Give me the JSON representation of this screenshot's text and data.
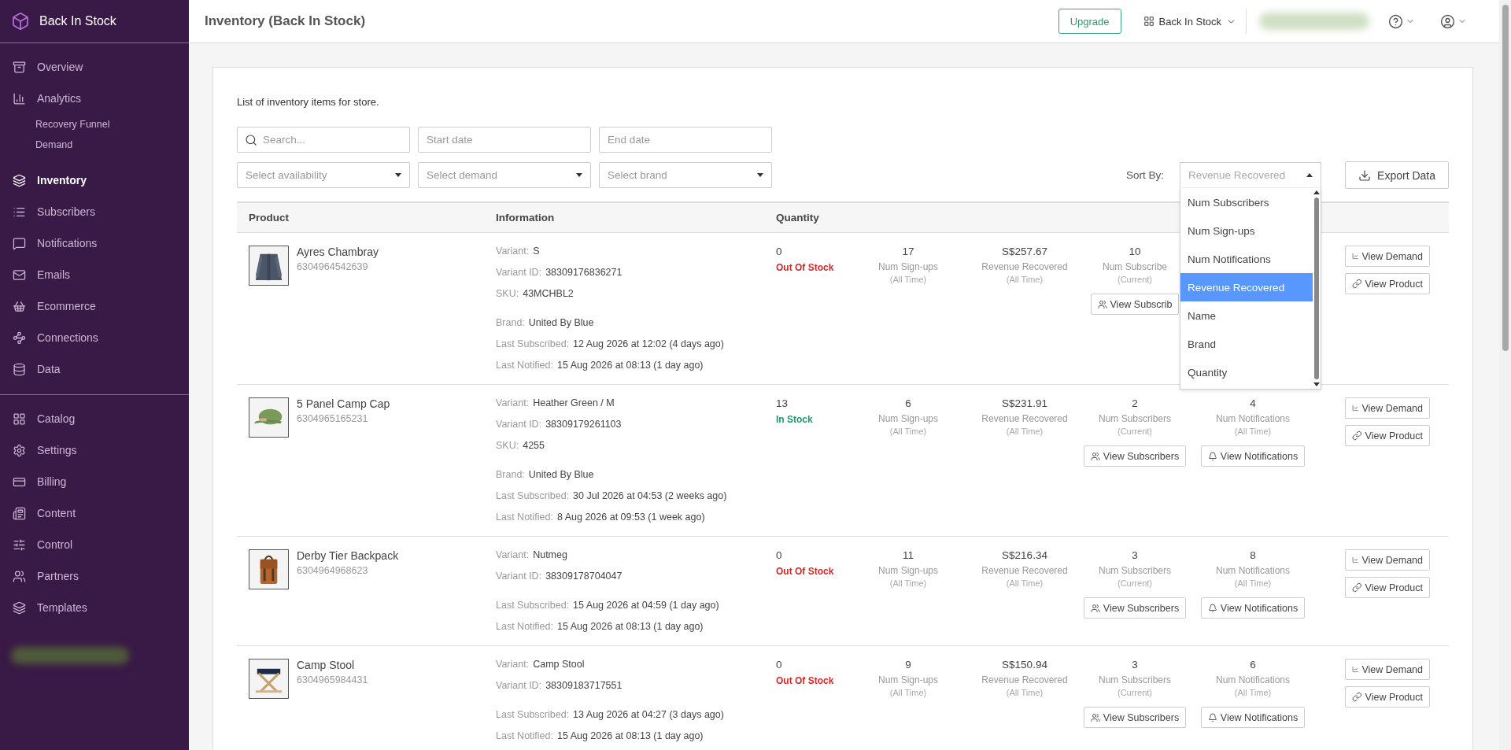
{
  "sidebar": {
    "brand": "Back In Stock",
    "sections": [
      {
        "items": [
          {
            "label": "Overview",
            "selected": false
          },
          {
            "label": "Analytics",
            "selected": false,
            "children": [
              {
                "label": "Recovery Funnel",
                "selected": false
              },
              {
                "label": "Demand",
                "selected": false
              }
            ]
          },
          {
            "label": "Inventory",
            "selected": true
          },
          {
            "label": "Subscribers",
            "selected": false
          },
          {
            "label": "Notifications",
            "selected": false
          },
          {
            "label": "Emails",
            "selected": false
          },
          {
            "label": "Ecommerce",
            "selected": false
          },
          {
            "label": "Connections",
            "selected": false
          },
          {
            "label": "Data",
            "selected": false
          }
        ]
      },
      {
        "items": [
          {
            "label": "Catalog",
            "selected": false
          },
          {
            "label": "Settings",
            "selected": false
          },
          {
            "label": "Billing",
            "selected": false
          },
          {
            "label": "Content",
            "selected": false
          },
          {
            "label": "Control",
            "selected": false
          },
          {
            "label": "Partners",
            "selected": false
          },
          {
            "label": "Templates",
            "selected": false
          }
        ]
      }
    ]
  },
  "header": {
    "title": "Inventory (Back In Stock)",
    "upgrade": "Upgrade",
    "store": "Back In Stock"
  },
  "content": {
    "description": "List of inventory items for store.",
    "search": {
      "placeholder": "Search..."
    },
    "start_date": {
      "placeholder": "Start date"
    },
    "end_date": {
      "placeholder": "End date"
    },
    "selects": [
      {
        "placeholder": "Select availability"
      },
      {
        "placeholder": "Select demand"
      },
      {
        "placeholder": "Select brand"
      }
    ],
    "sort": {
      "label": "Sort By:",
      "placeholder": "Revenue Recovered",
      "expanded": true,
      "options": [
        {
          "label": "Num Subscribers",
          "selected": false
        },
        {
          "label": "Num Sign-ups",
          "selected": false
        },
        {
          "label": "Num Notifications",
          "selected": false
        },
        {
          "label": "Revenue Recovered",
          "selected": true
        },
        {
          "label": "Name",
          "selected": false
        },
        {
          "label": "Brand",
          "selected": false
        },
        {
          "label": "Quantity",
          "selected": false
        }
      ]
    },
    "export": "Export Data"
  },
  "table": {
    "columns": [
      "Product",
      "Information",
      "Quantity"
    ],
    "rows": [
      {
        "name": "Ayres Chambray",
        "id": "6304964542639",
        "picture": {
          "kind": "picture"
        },
        "info": [
          [
            {
              "label": "Variant:",
              "value": "S"
            },
            {
              "label": "Variant ID:",
              "value": "38309176836271"
            },
            {
              "label": "SKU:",
              "value": "43MCHBL2"
            }
          ],
          [
            {
              "label": "Brand:",
              "value": "United By Blue"
            },
            {
              "label": "Last Subscribed:",
              "value": "12 Aug 2026 at 12:02 (4 days ago)"
            },
            {
              "label": "Last Notified:",
              "value": "15 Aug 2026 at 08:13 (1 day ago)"
            }
          ]
        ],
        "quantity": "0",
        "in_stock": false,
        "stock_label": "Out Of Stock",
        "stats": [
          {
            "value": "17",
            "label": "Num Sign-ups",
            "period": "(All Time)"
          },
          {
            "value": "S$257.67",
            "label": "Revenue Recovered",
            "period": "(All Time)"
          },
          {
            "value": "10",
            "label": "Num Subscribe",
            "period": "(Current)",
            "button": "View Subscrib"
          }
        ],
        "actions": [
          "View Demand",
          "View Product"
        ]
      },
      {
        "name": "5 Panel Camp Cap",
        "id": "6304965165231",
        "picture": {
          "kind": "picture"
        },
        "info": [
          [
            {
              "label": "Variant:",
              "value": "Heather Green / M"
            },
            {
              "label": "Variant ID:",
              "value": "38309179261103"
            },
            {
              "label": "SKU:",
              "value": "4255"
            }
          ],
          [
            {
              "label": "Brand:",
              "value": "United By Blue"
            },
            {
              "label": "Last Subscribed:",
              "value": "30 Jul 2026 at 04:53 (2 weeks ago)"
            },
            {
              "label": "Last Notified:",
              "value": "8 Aug 2026 at 09:53 (1 week ago)"
            }
          ]
        ],
        "quantity": "13",
        "in_stock": true,
        "stock_label": "In Stock",
        "stats": [
          {
            "value": "6",
            "label": "Num Sign-ups",
            "period": "(All Time)"
          },
          {
            "value": "S$231.91",
            "label": "Revenue Recovered",
            "period": "(All Time)"
          },
          {
            "value": "2",
            "label": "Num Subscribers",
            "period": "(Current)",
            "button": "View Subscribers"
          },
          {
            "value": "4",
            "label": "Num Notifications",
            "period": "(All Time)",
            "button": "View Notifications"
          }
        ],
        "actions": [
          "View Demand",
          "View Product"
        ]
      },
      {
        "name": "Derby Tier Backpack",
        "id": "6304964968623",
        "picture": {
          "kind": "picture"
        },
        "info": [
          [
            {
              "label": "Variant:",
              "value": "Nutmeg"
            },
            {
              "label": "Variant ID:",
              "value": "38309178704047"
            }
          ],
          [
            {
              "label": "Last Subscribed:",
              "value": "15 Aug 2026 at 04:59 (1 day ago)"
            },
            {
              "label": "Last Notified:",
              "value": "15 Aug 2026 at 08:13 (1 day ago)"
            }
          ]
        ],
        "quantity": "0",
        "in_stock": false,
        "stock_label": "Out Of Stock",
        "stats": [
          {
            "value": "11",
            "label": "Num Sign-ups",
            "period": "(All Time)"
          },
          {
            "value": "S$216.34",
            "label": "Revenue Recovered",
            "period": "(All Time)"
          },
          {
            "value": "3",
            "label": "Num Subscribers",
            "period": "(Current)",
            "button": "View Subscribers"
          },
          {
            "value": "8",
            "label": "Num Notifications",
            "period": "(All Time)",
            "button": "View Notifications"
          }
        ],
        "actions": [
          "View Demand",
          "View Product"
        ]
      },
      {
        "name": "Camp Stool",
        "id": "6304965984431",
        "picture": {
          "kind": "picture"
        },
        "info": [
          [
            {
              "label": "Variant:",
              "value": "Camp Stool"
            },
            {
              "label": "Variant ID:",
              "value": "38309183717551"
            }
          ],
          [
            {
              "label": "Last Subscribed:",
              "value": "13 Aug 2026 at 04:27 (3 days ago)"
            },
            {
              "label": "Last Notified:",
              "value": "15 Aug 2026 at 08:13 (1 day ago)"
            }
          ]
        ],
        "quantity": "0",
        "in_stock": false,
        "stock_label": "Out Of Stock",
        "stats": [
          {
            "value": "9",
            "label": "Num Sign-ups",
            "period": "(All Time)"
          },
          {
            "value": "S$150.94",
            "label": "Revenue Recovered",
            "period": "(All Time)"
          },
          {
            "value": "3",
            "label": "Num Subscribers",
            "period": "(Current)",
            "button": "View Subscribers"
          },
          {
            "value": "6",
            "label": "Num Notifications",
            "period": "(All Time)",
            "button": "View Notifications"
          }
        ],
        "actions": [
          "View Demand",
          "View Product"
        ]
      }
    ]
  }
}
